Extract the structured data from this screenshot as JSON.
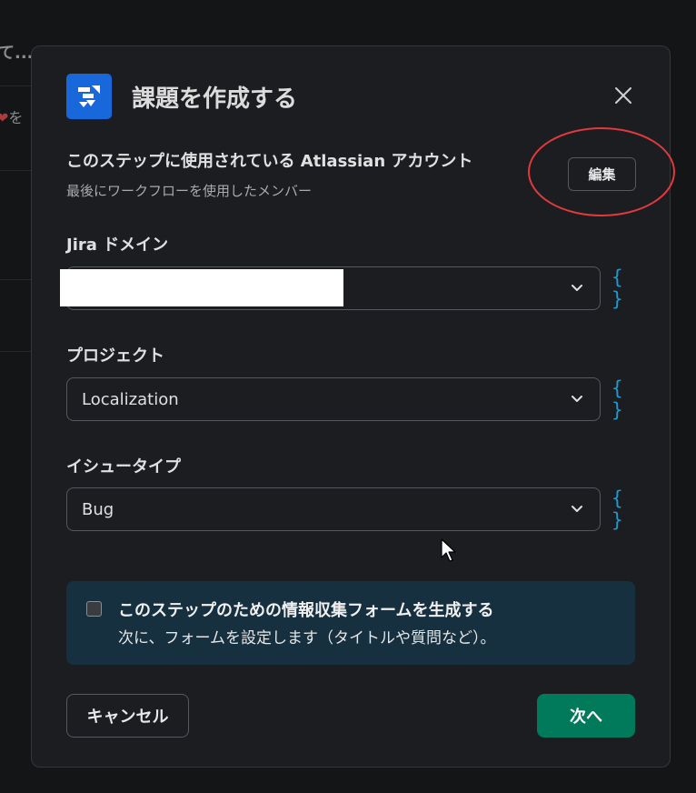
{
  "background": {
    "text_1": "て...",
    "text_2_heart": "❤",
    "text_2": "を"
  },
  "modal": {
    "title": "課題を作成する",
    "app_icon": "jira-icon",
    "close_icon": "close-icon",
    "account": {
      "title": "このステップに使用されている Atlassian アカウント",
      "subtitle": "最後にワークフローを使用したメンバー",
      "edit_label": "編集"
    },
    "fields": [
      {
        "label": "Jira ドメイン",
        "value": "",
        "var_label": "{ }"
      },
      {
        "label": "プロジェクト",
        "value": "Localization",
        "var_label": "{ }"
      },
      {
        "label": "イシュータイプ",
        "value": "Bug",
        "var_label": "{ }"
      }
    ],
    "form_option": {
      "checked": false,
      "title": "このステップのための情報収集フォームを生成する",
      "subtitle": "次に、フォームを設定します（タイトルや質問など）。"
    },
    "cancel_label": "キャンセル",
    "next_label": "次へ"
  },
  "colors": {
    "accent_green": "#007a5a",
    "variable_blue": "#1d9bd1",
    "jira_blue": "#1868db",
    "annotation_red": "#e0393e",
    "info_box": "#16303f"
  }
}
